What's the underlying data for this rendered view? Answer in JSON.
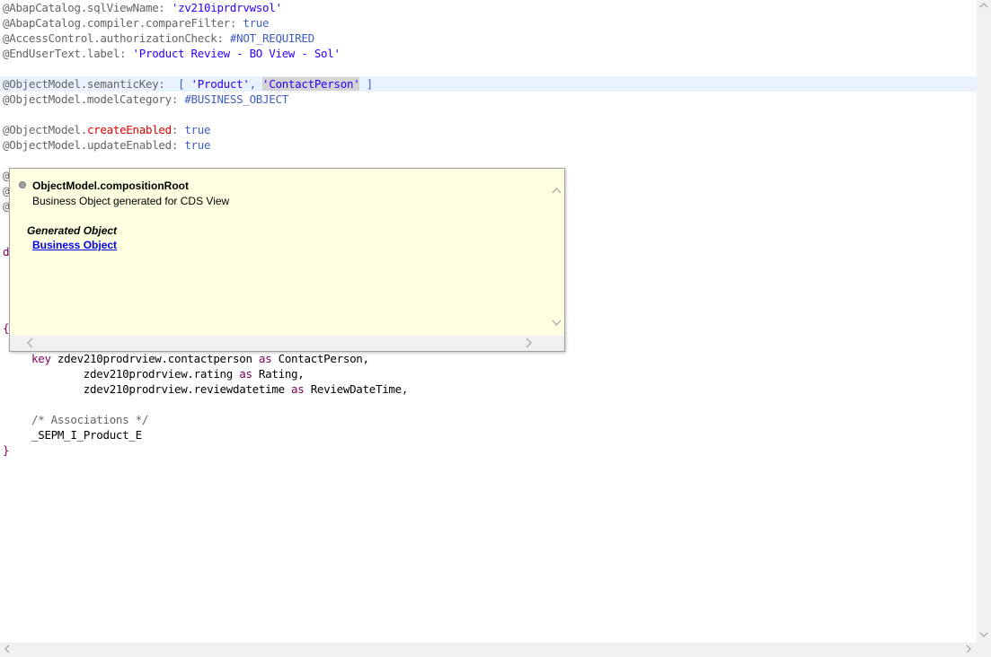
{
  "code": {
    "line1": {
      "a": "@AbapCatalog.sqlViewName: ",
      "b": "'zv210iprdrvwsol'"
    },
    "line2": {
      "a": "@AbapCatalog.compiler.compareFilter: ",
      "b": "true"
    },
    "line3": {
      "a": "@AccessControl.authorizationCheck: ",
      "b": "#NOT_REQUIRED"
    },
    "line4": {
      "a": "@EndUserText.label: ",
      "b": "'Product Review - BO View - Sol'"
    },
    "line5": {
      "a": "@ObjectModel.semanticKey:  ",
      "b": "[ ",
      "c": "'Product'",
      "d": ", ",
      "e": "'ContactPerson'",
      "f": " ]"
    },
    "line6": {
      "a": "@ObjectModel.modelCategory: ",
      "b": "#BUSINESS_OBJECT"
    },
    "line7": {
      "a": "@ObjectModel.",
      "b": "createEnabled",
      "c": ": ",
      "d": "true"
    },
    "line8": {
      "a": "@ObjectModel.",
      "b": "updateEnabled",
      "c": ": ",
      "d": "true"
    },
    "line9": {
      "a": "@"
    },
    "line10": {
      "a": "@"
    },
    "line11": {
      "a": "@"
    },
    "line12": {
      "a": "d"
    },
    "line13": {
      "a": "{"
    },
    "line14": {
      "kw": "key",
      "a": " zdev210prodrview.contactperson ",
      "as": "as",
      "b": " ContactPerson,"
    },
    "line15": {
      "a": "        zdev210prodrview.rating ",
      "as": "as",
      "b": " Rating,"
    },
    "line16": {
      "a": "        zdev210prodrview.reviewdatetime ",
      "as": "as",
      "b": " ReviewDateTime,"
    },
    "line17": {
      "a": "/* Associations */"
    },
    "line18": {
      "a": "_SEPM_I_Product_E"
    },
    "line19": {
      "a": "}"
    }
  },
  "popup": {
    "title": "ObjectModel.compositionRoot",
    "description": "Business Object generated for CDS View",
    "section_heading": "Generated Object",
    "link_label": "Business Object"
  },
  "colors": {
    "annotation": "#646464",
    "annotation_value": "#3f5fbf",
    "keyword": "#7f0055",
    "error_key": "#e00000",
    "popup_bg": "#ffffe1",
    "link": "#0000ee"
  },
  "icons": {
    "popup_bullet": "info-bullet-icon",
    "scroll_up": "chevron-up-icon",
    "scroll_down": "chevron-down-icon",
    "scroll_left": "chevron-left-icon",
    "scroll_right": "chevron-right-icon"
  }
}
